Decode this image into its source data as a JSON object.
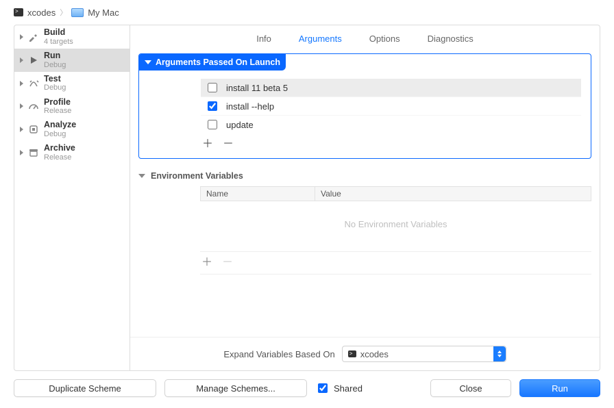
{
  "breadcrumb": {
    "app": "xcodes",
    "target": "My Mac"
  },
  "sidebar": {
    "items": [
      {
        "name": "Build",
        "sub": "4 targets"
      },
      {
        "name": "Run",
        "sub": "Debug"
      },
      {
        "name": "Test",
        "sub": "Debug"
      },
      {
        "name": "Profile",
        "sub": "Release"
      },
      {
        "name": "Analyze",
        "sub": "Debug"
      },
      {
        "name": "Archive",
        "sub": "Release"
      }
    ]
  },
  "tabs": {
    "info": "Info",
    "arguments": "Arguments",
    "options": "Options",
    "diagnostics": "Diagnostics"
  },
  "args": {
    "header": "Arguments Passed On Launch",
    "rows": [
      {
        "label": "install 11 beta 5",
        "checked": false
      },
      {
        "label": "install --help",
        "checked": true
      },
      {
        "label": "update",
        "checked": false
      }
    ]
  },
  "env": {
    "header": "Environment Variables",
    "col1": "Name",
    "col2": "Value",
    "empty": "No Environment Variables"
  },
  "expand": {
    "label": "Expand Variables Based On",
    "value": "xcodes"
  },
  "footer": {
    "duplicate": "Duplicate Scheme",
    "manage": "Manage Schemes...",
    "shared": "Shared",
    "close": "Close",
    "run": "Run"
  }
}
